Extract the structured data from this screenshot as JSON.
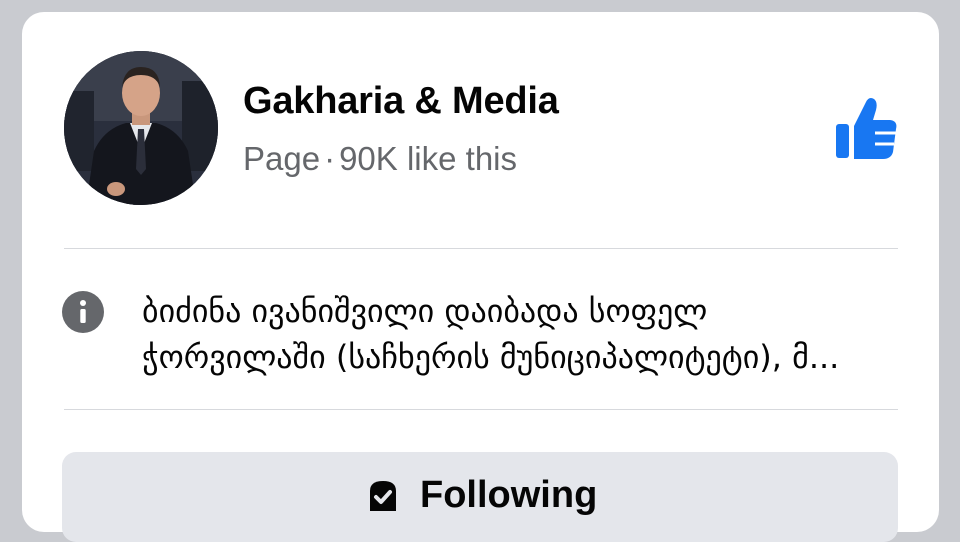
{
  "page": {
    "name": "Gakharia & Media",
    "category": "Page",
    "separator": "·",
    "likes_text": "90K like this"
  },
  "about": {
    "line1": "ბიძინა ივანიშვილი დაიბადა სოფელ",
    "line2": "ჭორვილაში (საჩხერის მუნიციპალიტეტი), მ..."
  },
  "actions": {
    "following_label": "Following"
  },
  "icons": {
    "like": "thumbs-up-icon",
    "info": "info-icon",
    "following": "following-icon",
    "avatar": "profile-avatar"
  },
  "colors": {
    "brand_blue": "#1877f2",
    "meta_gray": "#65676b",
    "info_gray": "#65676b",
    "button_bg": "#e4e6eb"
  }
}
